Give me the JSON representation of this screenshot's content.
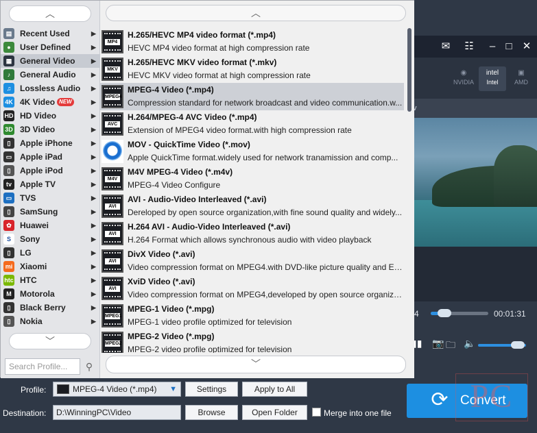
{
  "dialog": {
    "categories": [
      {
        "label": "Recent Used",
        "icon": "recent-icon",
        "color": "#6a7a8c",
        "glyph": "▤"
      },
      {
        "label": "User Defined",
        "icon": "user-defined-icon",
        "color": "#3d8a3c",
        "glyph": "●"
      },
      {
        "label": "General Video",
        "icon": "film-icon",
        "color": "#2c3440",
        "glyph": "▦",
        "selected": true
      },
      {
        "label": "General Audio",
        "icon": "audio-icon",
        "color": "#2f7a3a",
        "glyph": "♪"
      },
      {
        "label": "Lossless Audio",
        "icon": "music-note-icon",
        "color": "#1d8fe1",
        "glyph": "♫"
      },
      {
        "label": "4K Video",
        "icon": "4k-icon",
        "color": "#1d8fe1",
        "glyph": "4K",
        "badge": "NEW"
      },
      {
        "label": "HD Video",
        "icon": "hd-icon",
        "color": "#222",
        "glyph": "HD"
      },
      {
        "label": "3D Video",
        "icon": "3d-icon",
        "color": "#2f8a2f",
        "glyph": "3D"
      },
      {
        "label": "Apple iPhone",
        "icon": "iphone-icon",
        "color": "#333",
        "glyph": "▯"
      },
      {
        "label": "Apple iPad",
        "icon": "ipad-icon",
        "color": "#333",
        "glyph": "▭"
      },
      {
        "label": "Apple iPod",
        "icon": "ipod-icon",
        "color": "#555",
        "glyph": "▯"
      },
      {
        "label": "Apple TV",
        "icon": "apple-tv-icon",
        "color": "#222",
        "glyph": "tv"
      },
      {
        "label": "TVS",
        "icon": "tv-icon",
        "color": "#1d6fc1",
        "glyph": "▭"
      },
      {
        "label": "SamSung",
        "icon": "samsung-icon",
        "color": "#444",
        "glyph": "▯"
      },
      {
        "label": "Huawei",
        "icon": "huawei-icon",
        "color": "#d8232a",
        "glyph": "✿"
      },
      {
        "label": "Sony",
        "icon": "sony-icon",
        "color": "#fff",
        "glyph": "S",
        "fg": "#1d4fa0"
      },
      {
        "label": "LG",
        "icon": "lg-icon",
        "color": "#333",
        "glyph": "▯"
      },
      {
        "label": "Xiaomi",
        "icon": "xiaomi-icon",
        "color": "#f56a1d",
        "glyph": "mi"
      },
      {
        "label": "HTC",
        "icon": "htc-icon",
        "color": "#7ab800",
        "glyph": "htc"
      },
      {
        "label": "Motorola",
        "icon": "motorola-icon",
        "color": "#222",
        "glyph": "M"
      },
      {
        "label": "Black Berry",
        "icon": "blackberry-icon",
        "color": "#333",
        "glyph": "▯"
      },
      {
        "label": "Nokia",
        "icon": "nokia-icon",
        "color": "#555",
        "glyph": "▯"
      }
    ],
    "search_placeholder": "Search Profile...",
    "formats": [
      {
        "name": "H.265/HEVC MP4 video format (*.mp4)",
        "desc": "HEVC MP4 video format at high compression rate",
        "tag": "MP4"
      },
      {
        "name": "H.265/HEVC MKV video format (*.mkv)",
        "desc": "HEVC MKV video format at high compression rate",
        "tag": "MKV"
      },
      {
        "name": "MPEG-4 Video (*.mp4)",
        "desc": "Compression standard for network broadcast and video communication.w...",
        "tag": "MPEG4",
        "selected": true
      },
      {
        "name": "H.264/MPEG-4 AVC Video (*.mp4)",
        "desc": "Extension of MPEG4 video format.with high compression rate",
        "tag": "AVC"
      },
      {
        "name": "MOV - QuickTime Video (*.mov)",
        "desc": "Apple QuickTime format.widely used for network tranamission and comp...",
        "tag": "",
        "quicktime": true
      },
      {
        "name": "M4V MPEG-4 Video (*.m4v)",
        "desc": "MPEG-4 Video Configure",
        "tag": "M4V"
      },
      {
        "name": "AVI - Audio-Video Interleaved (*.avi)",
        "desc": "Dereloped by open source organization,with fine sound quality and widely...",
        "tag": "AVI"
      },
      {
        "name": "H.264 AVI - Audio-Video Interleaved (*.avi)",
        "desc": "H.264 Format which allows synchronous audio with video playback",
        "tag": "AVI"
      },
      {
        "name": "DivX Video (*.avi)",
        "desc": "Video compression format on MPEG4.with DVD-like picture quality and Ex...",
        "tag": "AVI"
      },
      {
        "name": "XviD Video (*.avi)",
        "desc": "Video compression format on MPEG4,developed by open source organizat...",
        "tag": "AVI"
      },
      {
        "name": "MPEG-1 Video (*.mpg)",
        "desc": "MPEG-1 video profile optimized for television",
        "tag": "MPEG1"
      },
      {
        "name": "MPEG-2 Video (*.mpg)",
        "desc": "MPEG-2 video profile optimized for television",
        "tag": "MPEG2"
      }
    ]
  },
  "player": {
    "gpu": [
      {
        "label": "NVIDIA",
        "logo": "◉"
      },
      {
        "label": "Intel",
        "logo": "intel",
        "active": true
      },
      {
        "label": "AMD",
        "logo": "▣"
      }
    ],
    "time_start": "4",
    "time_end": "00:01:31",
    "progress": 0.15,
    "volume": 0.7
  },
  "bottom": {
    "profile_label": "Profile:",
    "profile_value": "MPEG-4 Video (*.mp4)",
    "settings_label": "Settings",
    "apply_all_label": "Apply to All",
    "destination_label": "Destination:",
    "destination_value": "D:\\WinningPC\\Video",
    "browse_label": "Browse",
    "open_folder_label": "Open Folder",
    "merge_label": "Merge into one file",
    "convert_label": "Convert"
  },
  "colors": {
    "accent": "#1d8fe1",
    "selection": "#cdd0d6",
    "dark_bg": "#2f3846"
  }
}
